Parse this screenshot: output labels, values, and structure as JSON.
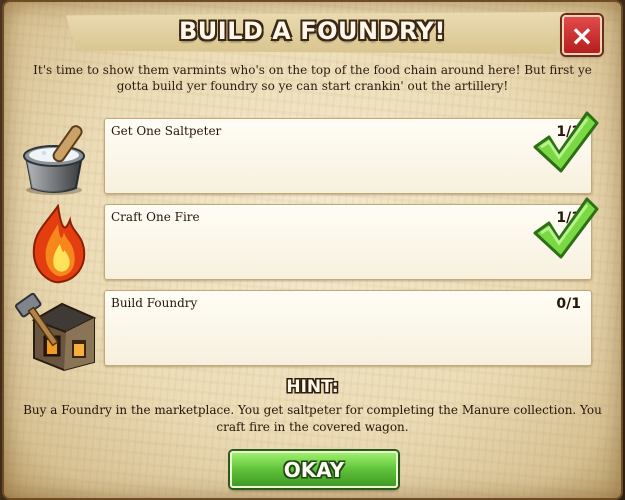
{
  "dialog": {
    "title": "BUILD A FOUNDRY!",
    "intro": "It's time to show them varmints who's on the top of the food chain around here! But first ye gotta build yer foundry so ye can start crankin' out the artillery!",
    "close_icon": "close-icon"
  },
  "tasks": [
    {
      "label": "Get One Saltpeter",
      "count": "1/1",
      "complete": true,
      "icon": "saltpeter-icon"
    },
    {
      "label": "Craft One Fire",
      "count": "1/1",
      "complete": true,
      "icon": "fire-icon"
    },
    {
      "label": "Build Foundry",
      "count": "0/1",
      "complete": false,
      "icon": "foundry-icon"
    }
  ],
  "hint": {
    "label": "HINT:",
    "text": "Buy a Foundry in the marketplace. You get saltpeter for completing the Manure collection. You craft fire in the covered wagon."
  },
  "buttons": {
    "okay": "OKAY",
    "close": "×"
  },
  "colors": {
    "check": "#6fd33b",
    "okay_green": "#5fc23a",
    "close_red": "#c62a2a"
  }
}
